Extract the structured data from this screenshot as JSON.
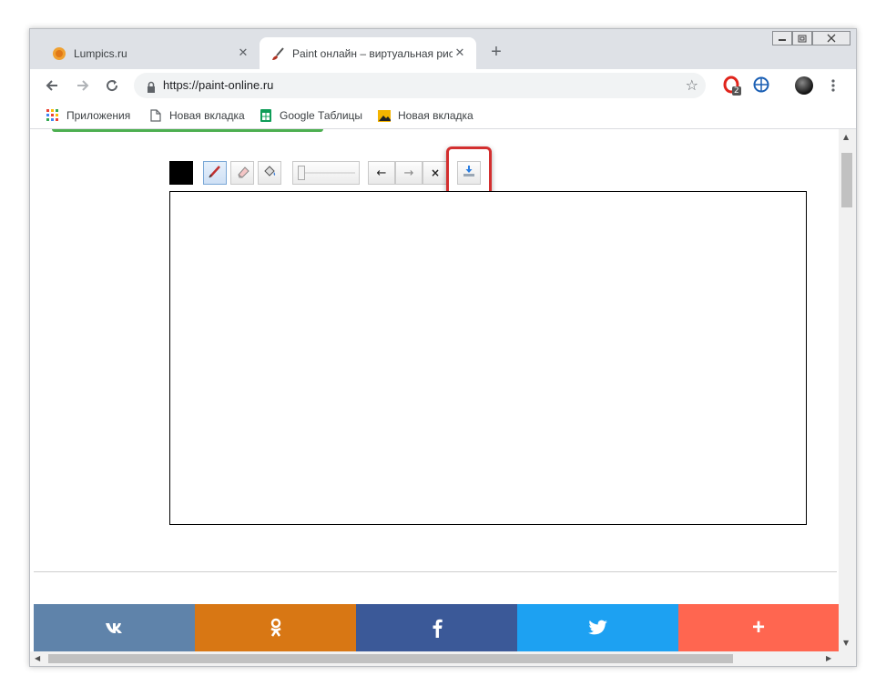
{
  "window_controls": {
    "minimize": "▭",
    "restore": "⧉",
    "close": "✕"
  },
  "tabs": [
    {
      "title": "Lumpics.ru",
      "close": "✕",
      "favicon": "lumpics-orange-icon"
    },
    {
      "title": "Paint онлайн – виртуальная рис",
      "close": "✕",
      "favicon": "paint-brush-icon"
    }
  ],
  "new_tab_label": "+",
  "address_bar": {
    "url": "https://paint-online.ru",
    "star": "☆"
  },
  "extensions": {
    "opera_badge": "2"
  },
  "bookmarks": [
    {
      "label": "Приложения",
      "icon": "apps-grid-icon"
    },
    {
      "label": "Новая вкладка",
      "icon": "page-icon"
    },
    {
      "label": "Google Таблицы",
      "icon": "sheets-icon"
    },
    {
      "label": "Новая вкладка",
      "icon": "image-icon"
    }
  ],
  "paint_tools": {
    "color": "#000000",
    "undo": "←",
    "redo": "→",
    "clear": "×"
  },
  "share_buttons": [
    {
      "label": "vk",
      "color": "#5f83aa"
    },
    {
      "label": "ok",
      "color": "#d87714"
    },
    {
      "label": "f",
      "color": "#3b5998"
    },
    {
      "label": "tw",
      "color": "#1da1f2"
    },
    {
      "label": "+",
      "color": "#ff6650"
    }
  ],
  "colors": {
    "highlight": "#d32f2f",
    "loading_bar": "#4caf50"
  }
}
